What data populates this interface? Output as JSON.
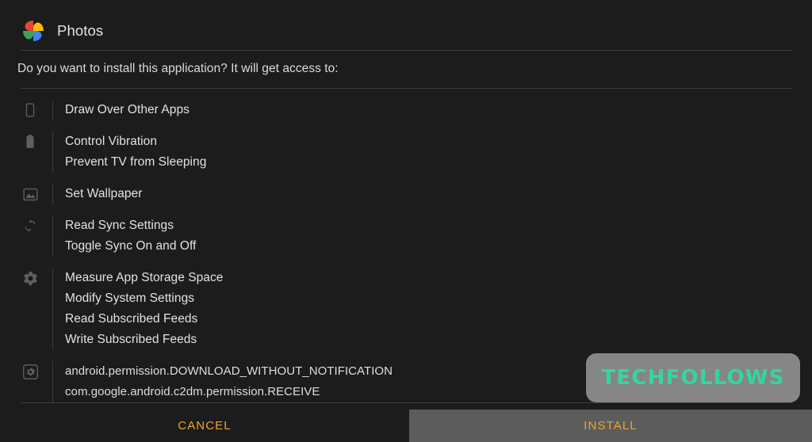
{
  "dialog": {
    "app_title": "Photos",
    "app_icon": "google-photos-pinwheel-icon",
    "prompt": "Do you want to install this application? It will get access to:"
  },
  "permission_groups": [
    {
      "icon": "phone-device-icon",
      "lines": [
        "Draw Over Other Apps"
      ]
    },
    {
      "icon": "battery-vibration-icon",
      "lines": [
        "Control Vibration",
        "Prevent TV from Sleeping"
      ]
    },
    {
      "icon": "wallpaper-image-icon",
      "lines": [
        "Set Wallpaper"
      ]
    },
    {
      "icon": "sync-arrows-icon",
      "lines": [
        "Read Sync Settings",
        "Toggle Sync On and Off"
      ]
    },
    {
      "icon": "gear-settings-icon",
      "lines": [
        "Measure App Storage Space",
        "Modify System Settings",
        "Read Subscribed Feeds",
        "Write Subscribed Feeds"
      ]
    },
    {
      "icon": "boxed-gear-unknown-permission-icon",
      "raw": true,
      "lines": [
        "android.permission.DOWNLOAD_WITHOUT_NOTIFICATION",
        "com.google.android.c2dm.permission.RECEIVE"
      ]
    }
  ],
  "footer": {
    "cancel_label": "CANCEL",
    "install_label": "INSTALL"
  },
  "watermark": {
    "text": "TECHFOLLOWS"
  },
  "colors": {
    "background": "#1c1c1c",
    "divider": "#3d3d3d",
    "text": "#e2e2e2",
    "icon": "#5e5e5e",
    "accent_button_text": "#efa52c",
    "install_button_bg": "#5c5c5c",
    "watermark_bg": "#868686",
    "watermark_text": "#33d79e"
  }
}
